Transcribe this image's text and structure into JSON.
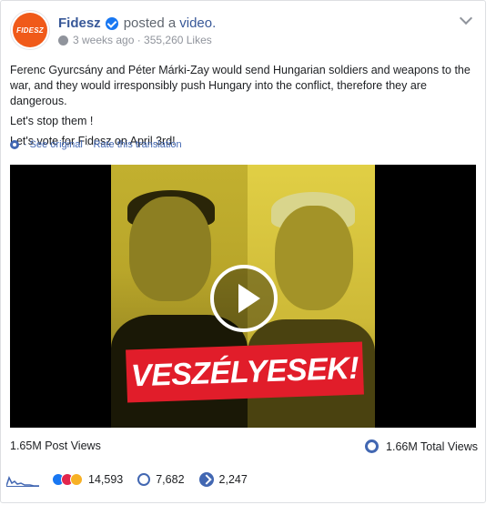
{
  "post": {
    "page_name": "Fidesz",
    "avatar_text": "FIDESZ",
    "action": "posted a",
    "action_link": "video.",
    "meta": "3 weeks ago · 355,260 Likes",
    "paragraphs": [
      "Ferenc Gyurcsány and Péter Márki-Zay would send Hungarian soldiers and weapons to the war, and they would irresponsibly push Hungary into the conflict, therefore they are dangerous.",
      "Let's stop them !",
      "Let's vote for Fidesz on April 3rd!"
    ],
    "see_original": "See original",
    "separator": "·",
    "rate_translation": "Rate this translation"
  },
  "video": {
    "banner_text": "VESZÉLYESEK!"
  },
  "views": {
    "post_views": "1.65M Post Views",
    "total_views": "1.66M Total Views"
  },
  "stats": {
    "reactions": "14,593",
    "comments": "7,682",
    "shares": "2,247"
  },
  "colors": {
    "link": "#385898",
    "accent": "#4267b2",
    "brand_orange": "#f05a1a",
    "banner_red": "#e11d2a"
  }
}
